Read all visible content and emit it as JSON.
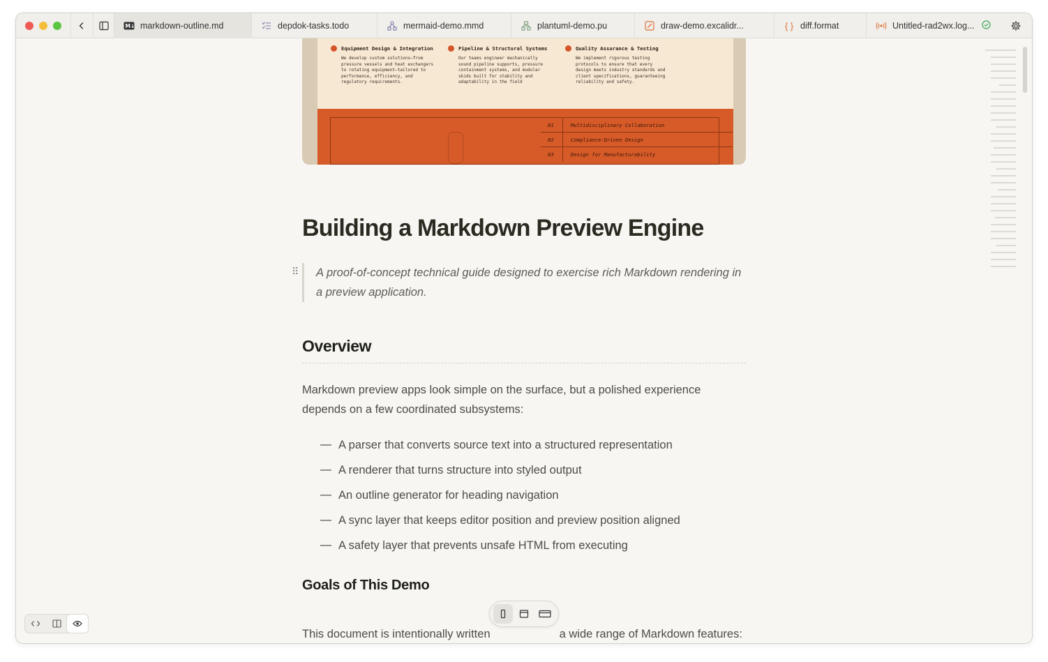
{
  "tabs": [
    {
      "label": "markdown-outline.md",
      "icon": "markdown-icon",
      "active": true
    },
    {
      "label": "depdok-tasks.todo",
      "icon": "checklist-icon",
      "active": false
    },
    {
      "label": "mermaid-demo.mmd",
      "icon": "mermaid-icon",
      "active": false
    },
    {
      "label": "plantuml-demo.pu",
      "icon": "plantuml-icon",
      "active": false
    },
    {
      "label": "draw-demo.excalidr...",
      "icon": "excalidraw-icon",
      "active": false
    },
    {
      "label": "diff.format",
      "icon": "braces-icon",
      "active": false
    },
    {
      "label": "Untitled-rad2wx.log...",
      "icon": "broadcast-icon",
      "active": false
    }
  ],
  "hero": {
    "columns": [
      {
        "title": "Equipment Design & Integration",
        "body": "We develop custom solutions—from pressure vessels and heat exchangers to rotating equipment—tailored to performance, efficiency, and regulatory requirements."
      },
      {
        "title": "Pipeline & Structural Systems",
        "body": "Our teams engineer mechanically sound pipeline supports, pressure containment systems, and modular skids built for stability and adaptability in the field"
      },
      {
        "title": "Quality Assurance & Testing",
        "body": "We implement rigorous testing protocols to ensure that every design meets industry standards and client specifications, guaranteeing reliability and safety."
      }
    ],
    "table": [
      {
        "num": "01",
        "label": "Multidisciplinary Collaboration"
      },
      {
        "num": "02",
        "label": "Compliance-Driven Design"
      },
      {
        "num": "03",
        "label": "Design for Manufacturability"
      }
    ]
  },
  "doc": {
    "title": "Building a Markdown Preview Engine",
    "quote": "A proof-of-concept technical guide designed to exercise rich Markdown rendering in a preview application.",
    "overview_heading": "Overview",
    "overview_para": "Markdown preview apps look simple on the surface, but a polished experience depends on a few coordinated subsystems:",
    "bullets": [
      "A parser that converts source text into a structured representation",
      "A renderer that turns structure into styled output",
      "An outline generator for heading navigation",
      "A sync layer that keeps editor position and preview position aligned",
      "A safety layer that prevents unsafe HTML from executing"
    ],
    "goals_heading": "Goals of This Demo",
    "goals_para_start": "This document is intentionally written",
    "goals_para_end": "a wide range of Markdown features:"
  },
  "colors": {
    "hero_orange": "#d65b28",
    "hero_cream": "#f7e8d3",
    "status_ok": "#3aa65a"
  }
}
